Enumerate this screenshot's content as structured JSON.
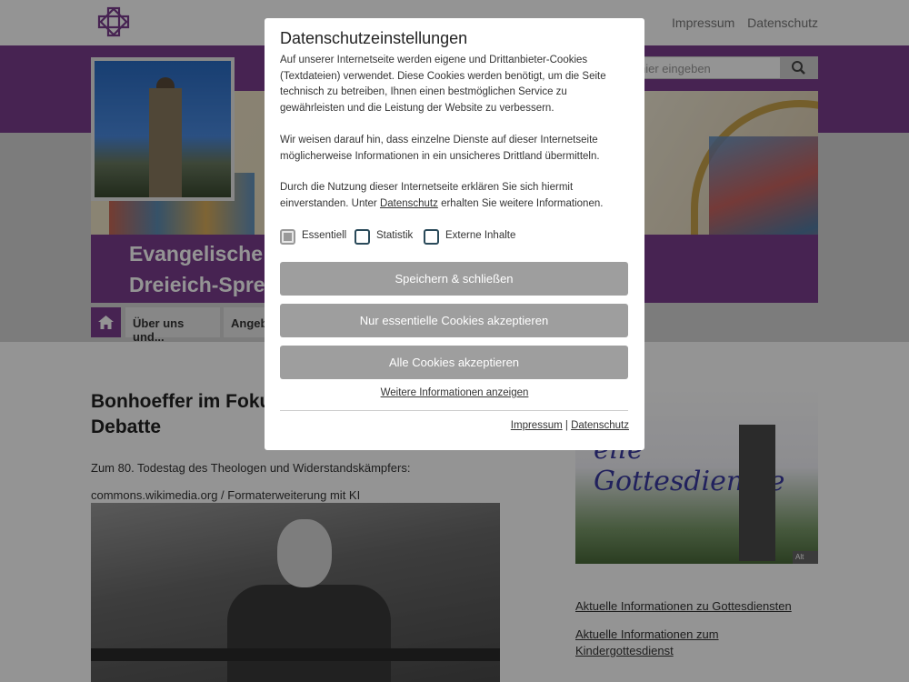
{
  "topbar": {
    "impressum": "Impressum",
    "datenschutz": "Datenschutz"
  },
  "header": {
    "search_placeholder": "hier eingeben",
    "title_line1": "Evangelische E",
    "title_line2": "Dreieich-Spren"
  },
  "nav": {
    "item1": "Über uns und...",
    "item2": "Angeb"
  },
  "article": {
    "title": "Bonhoeffer im Foku Debatte",
    "text": "Zum 80. Todestag des Theologen und Widerstandskämpfers:",
    "credit": "commons.wikimedia.org / Formaterweiterung mit KI"
  },
  "sidebar": {
    "image_script": "elle Gottesdienste",
    "image_caption": "Alt",
    "link1": "Aktuelle Informationen zu Gottesdiensten",
    "link2": "Aktuelle Informationen zum Kindergottesdienst"
  },
  "modal": {
    "title": "Datenschutzeinstellungen",
    "para1": "Auf unserer Internetseite werden eigene und Drittanbieter-Cookies (Textdateien) verwendet. Diese Cookies werden benötigt, um die Seite technisch zu betreiben, Ihnen einen bestmöglichen Service zu gewährleisten und die Leistung der Website zu verbessern.",
    "para2": "Wir weisen darauf hin, dass einzelne Dienste auf dieser Internetseite möglicherweise Informationen in ein unsicheres Drittland übermitteln.",
    "para3_a": "Durch die Nutzung dieser Internetseite erklären Sie sich hiermit einverstanden. Unter ",
    "para3_link": "Datenschutz",
    "para3_b": " erhalten Sie weitere Informationen.",
    "opt_essentiell": "Essentiell",
    "opt_statistik": "Statistik",
    "opt_extern": "Externe Inhalte",
    "btn_save": "Speichern & schließen",
    "btn_essential": "Nur essentielle Cookies akzeptieren",
    "btn_all": "Alle Cookies akzeptieren",
    "more": "Weitere Informationen anzeigen",
    "foot_impressum": "Impressum",
    "foot_sep": " | ",
    "foot_datenschutz": "Datenschutz"
  }
}
